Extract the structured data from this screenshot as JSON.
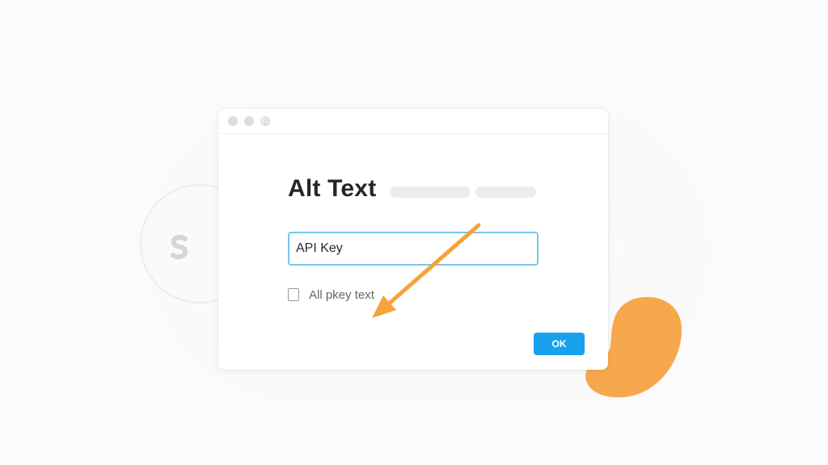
{
  "dialog": {
    "title": "Alt Text",
    "input_value": "API Key",
    "checkbox_label": "All pkey text",
    "ok_label": "OK"
  },
  "colors": {
    "accent_blue": "#1aa1ed",
    "input_border": "#7cc4ee",
    "annotation_orange": "#f5a33a",
    "blob_orange": "#f7a84c"
  },
  "icons": {
    "traffic_close": "window-close-icon",
    "traffic_minimize": "window-minimize-icon",
    "traffic_zoom": "window-zoom-icon",
    "badge_glyph": "dollar-glyph-icon",
    "annotation": "pointer-arrow-icon",
    "decoration": "orange-blob-icon"
  }
}
